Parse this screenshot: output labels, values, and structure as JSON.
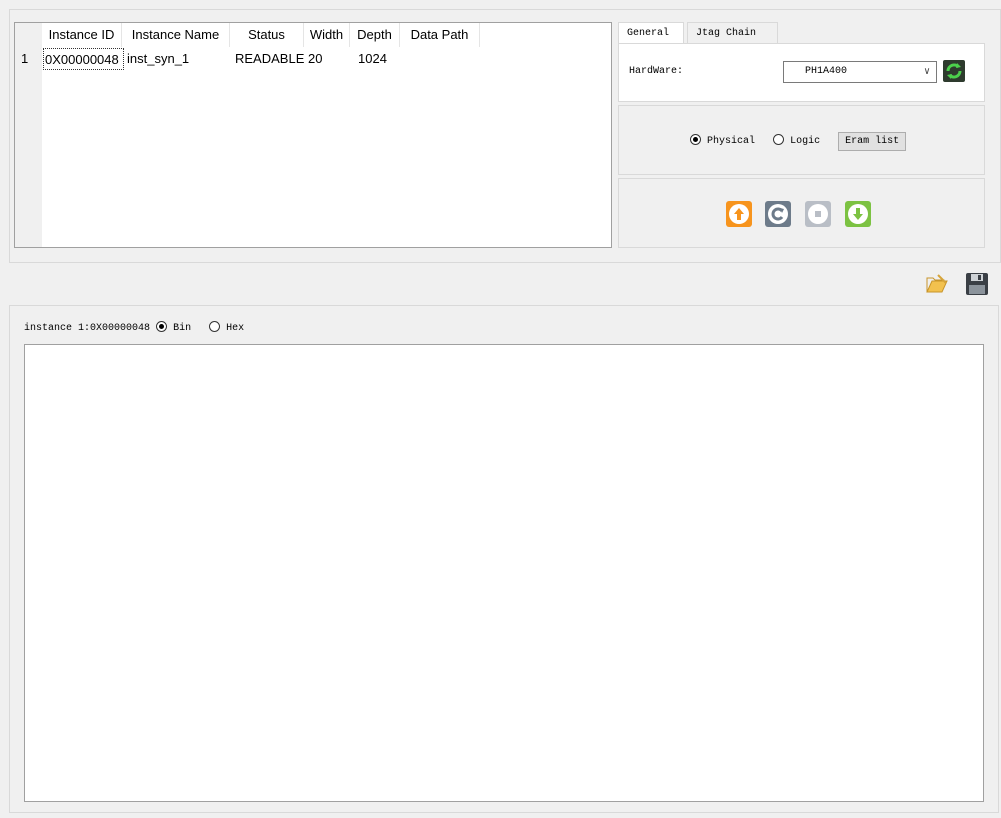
{
  "table": {
    "columns": [
      "Instance ID",
      "Instance Name",
      "Status",
      "Width",
      "Depth",
      "Data Path"
    ],
    "rows": [
      {
        "index": "1",
        "id": "0X00000048",
        "name": "inst_syn_1",
        "status": "READABLE",
        "width": "20",
        "depth": "1024",
        "path": ""
      }
    ]
  },
  "tabs": {
    "general": "General",
    "jtag": "Jtag Chain"
  },
  "hardware": {
    "label": "HardWare:",
    "selected": "PH1A400"
  },
  "mode": {
    "physical": "Physical",
    "logic": "Logic",
    "eram_list": "Eram list",
    "selected": "Physical"
  },
  "instance": {
    "label": "instance 1:0X00000048",
    "bin": "Bin",
    "hex": "Hex",
    "selected": "Bin"
  },
  "colors": {
    "upload": "#f7941d",
    "refresh": "#6d7b8a",
    "stop": "#b9bec6",
    "download": "#7cc242",
    "sync": "#2e8b2e"
  }
}
